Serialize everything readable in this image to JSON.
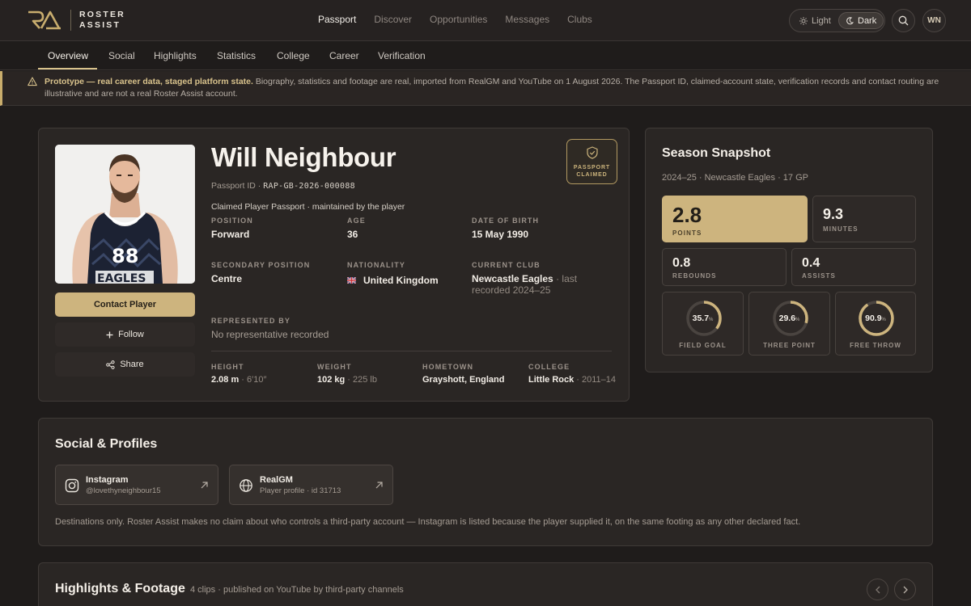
{
  "brand": {
    "line1": "ROSTER",
    "line2": "ASSIST"
  },
  "nav": {
    "items": [
      {
        "label": "Passport",
        "active": true
      },
      {
        "label": "Discover"
      },
      {
        "label": "Opportunities"
      },
      {
        "label": "Messages"
      },
      {
        "label": "Clubs"
      }
    ]
  },
  "theme": {
    "light": "Light",
    "dark": "Dark",
    "selected": "Dark"
  },
  "user": {
    "initials": "WN"
  },
  "icons": {
    "search": "search-icon",
    "sun": "sun-icon",
    "moon": "moon-icon",
    "warning": "warning-icon",
    "shield": "shield-check-icon",
    "plus": "plus-icon",
    "share": "share-icon",
    "instagram": "instagram-icon",
    "globe": "globe-icon",
    "arrow": "arrow-up-right-icon"
  },
  "tabs": [
    {
      "label": "Overview",
      "active": true
    },
    {
      "label": "Social"
    },
    {
      "label": "Highlights"
    },
    {
      "label": "Statistics"
    },
    {
      "label": "College"
    },
    {
      "label": "Career"
    },
    {
      "label": "Verification"
    }
  ],
  "banner": {
    "strong": "Prototype — real career data, staged platform state.",
    "text": " Biography, statistics and footage are real, imported from RealGM and YouTube on 1 August 2026. The Passport ID, claimed-account state, verification records and contact routing are illustrative and are not a real Roster Assist account."
  },
  "profile": {
    "name": "Will Neighbour",
    "passport_label": "Passport ID · ",
    "passport_id": "RAP-GB-2026-000088",
    "claimed_line": "Claimed Player Passport · maintained by the player",
    "badge": {
      "line1": "PASSPORT",
      "line2": "CLAIMED"
    },
    "buttons": {
      "contact": "Contact Player",
      "follow": "Follow",
      "share": "Share"
    },
    "fields": {
      "position": {
        "label": "POSITION",
        "value": "Forward"
      },
      "age": {
        "label": "AGE",
        "value": "36"
      },
      "dob": {
        "label": "DATE OF BIRTH",
        "value": "15 May 1990"
      },
      "secondary": {
        "label": "SECONDARY POSITION",
        "value": "Centre"
      },
      "nationality": {
        "label": "NATIONALITY",
        "value": "United Kingdom"
      },
      "club": {
        "label": "CURRENT CLUB",
        "value": "Newcastle Eagles",
        "note1": " · last",
        "note2": "recorded 2024–25"
      },
      "represented": {
        "label": "REPRESENTED BY",
        "value": "No representative recorded"
      },
      "height": {
        "label": "HEIGHT",
        "value": "2.08 m",
        "sub": " · 6′10″"
      },
      "weight": {
        "label": "WEIGHT",
        "value": "102 kg",
        "sub": " · 225 lb"
      },
      "hometown": {
        "label": "HOMETOWN",
        "value": "Grayshott, England"
      },
      "college": {
        "label": "COLLEGE",
        "value": "Little Rock",
        "sub": " · 2011–14"
      }
    }
  },
  "snapshot": {
    "title": "Season Snapshot",
    "subtitle": "2024–25 · Newcastle Eagles · 17 GP",
    "points": {
      "value": "2.8",
      "label": "POINTS"
    },
    "minutes": {
      "value": "9.3",
      "label": "MINUTES"
    },
    "rebounds": {
      "value": "0.8",
      "label": "REBOUNDS"
    },
    "assists": {
      "value": "0.4",
      "label": "ASSISTS"
    },
    "rings": [
      {
        "value": "35.7",
        "unit": "%",
        "label": "FIELD GOAL",
        "pct": 35.7
      },
      {
        "value": "29.6",
        "unit": "%",
        "label": "THREE POINT",
        "pct": 29.6
      },
      {
        "value": "90.9",
        "unit": "%",
        "label": "FREE THROW",
        "pct": 90.9
      }
    ]
  },
  "social": {
    "title": "Social & Profiles",
    "links": [
      {
        "title": "Instagram",
        "sub": "@lovethyneighbour15"
      },
      {
        "title": "RealGM",
        "sub": "Player profile · id 31713"
      }
    ],
    "note": "Destinations only. Roster Assist makes no claim about who controls a third-party account — Instagram is listed because the player supplied it, on the same footing as any other declared fact."
  },
  "highlights": {
    "title": "Highlights & Footage",
    "subtitle": "4 clips · published on YouTube by third-party channels"
  },
  "colors": {
    "accent": "#cdb47e",
    "background": "#1f1c1b",
    "panel": "#2a2624"
  }
}
